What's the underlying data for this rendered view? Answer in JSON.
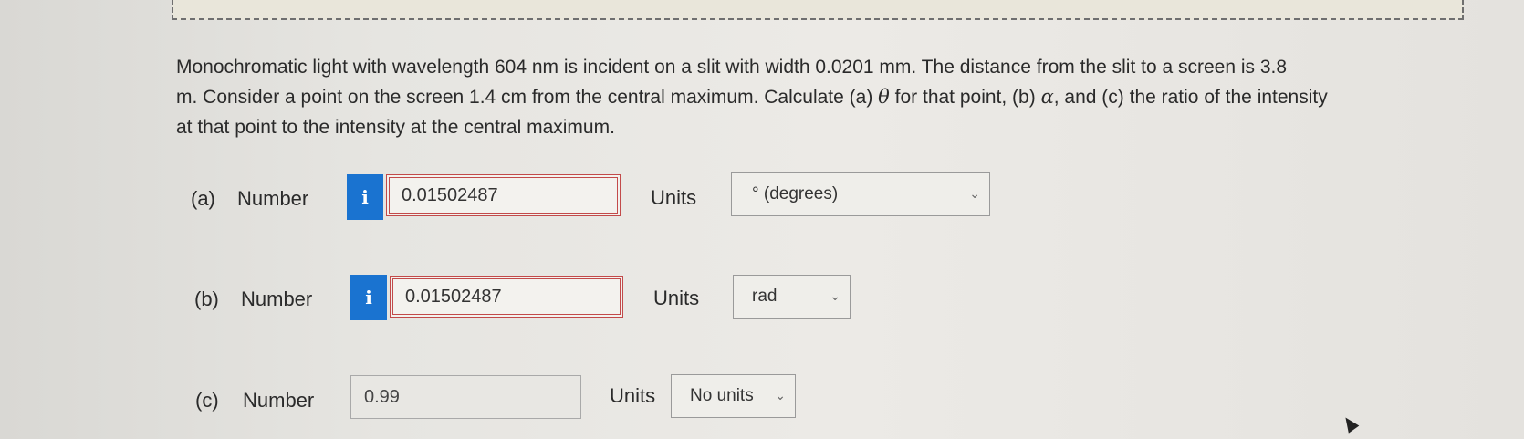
{
  "question": {
    "line1": "Monochromatic light with wavelength 604 nm is incident on a slit with width 0.0201 mm. The distance from the slit to a screen is 3.8",
    "line2_a": "m. Consider a point on the screen 1.4 cm from the central maximum. Calculate (a) ",
    "theta": "θ",
    "line2_b": " for that point, (b) ",
    "alpha": "α",
    "line2_c": ", and (c) the ratio of the intensity",
    "line3": "at that point to the intensity at the central maximum."
  },
  "parts": {
    "a": {
      "label": "(a)",
      "number_label": "Number",
      "info": "i",
      "value": "0.01502487",
      "units_label": "Units",
      "unit": "° (degrees)"
    },
    "b": {
      "label": "(b)",
      "number_label": "Number",
      "info": "i",
      "value": "0.01502487",
      "units_label": "Units",
      "unit": "rad"
    },
    "c": {
      "label": "(c)",
      "number_label": "Number",
      "value": "0.99",
      "units_label": "Units",
      "unit": "No units"
    }
  },
  "icons": {
    "info": "info-icon",
    "dropdown": "chevron-down-icon"
  },
  "colors": {
    "info_button": "#1a73d0",
    "answer_border": "#c24a4a"
  }
}
